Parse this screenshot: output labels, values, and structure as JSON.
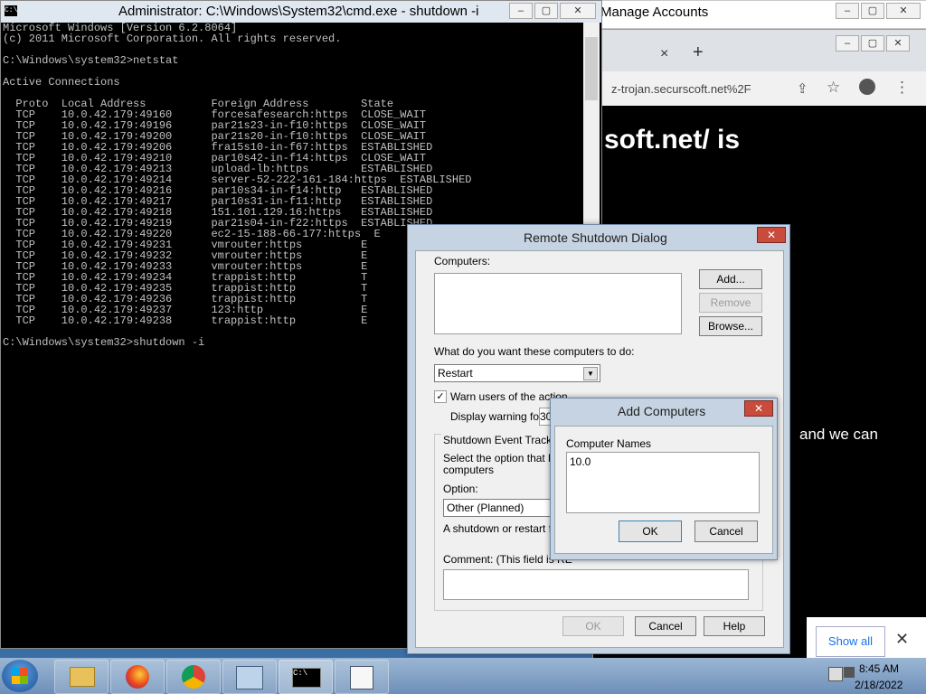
{
  "manage_window": {
    "title": "Manage Accounts"
  },
  "browser": {
    "tab_close": "×",
    "new_tab": "+",
    "url_fragment": "z-trojan.securscoft.net%2F",
    "heading_fragment": "soft.net/ is",
    "body_fragment": "and we can",
    "notification": {
      "show_all": "Show all",
      "close": "✕"
    }
  },
  "cmd": {
    "title": "Administrator: C:\\Windows\\System32\\cmd.exe - shutdown  -i",
    "lines": [
      "Microsoft Windows [Version 6.2.8064]",
      "(c) 2011 Microsoft Corporation. All rights reserved.",
      "",
      "C:\\Windows\\system32>netstat",
      "",
      "Active Connections",
      "",
      "  Proto  Local Address          Foreign Address        State",
      "  TCP    10.0.42.179:49160      forcesafesearch:https  CLOSE_WAIT",
      "  TCP    10.0.42.179:49196      par21s23-in-f10:https  CLOSE_WAIT",
      "  TCP    10.0.42.179:49200      par21s20-in-f10:https  CLOSE_WAIT",
      "  TCP    10.0.42.179:49206      fra15s10-in-f67:https  ESTABLISHED",
      "  TCP    10.0.42.179:49210      par10s42-in-f14:https  CLOSE_WAIT",
      "  TCP    10.0.42.179:49213      upload-lb:https        ESTABLISHED",
      "  TCP    10.0.42.179:49214      server-52-222-161-184:https  ESTABLISHED",
      "  TCP    10.0.42.179:49216      par10s34-in-f14:http   ESTABLISHED",
      "  TCP    10.0.42.179:49217      par10s31-in-f11:http   ESTABLISHED",
      "  TCP    10.0.42.179:49218      151.101.129.16:https   ESTABLISHED",
      "  TCP    10.0.42.179:49219      par21s04-in-f22:https  ESTABLISHED",
      "  TCP    10.0.42.179:49220      ec2-15-188-66-177:https  E",
      "  TCP    10.0.42.179:49231      vmrouter:https         E",
      "  TCP    10.0.42.179:49232      vmrouter:https         E",
      "  TCP    10.0.42.179:49233      vmrouter:https         E",
      "  TCP    10.0.42.179:49234      trappist:http          T",
      "  TCP    10.0.42.179:49235      trappist:http          T",
      "  TCP    10.0.42.179:49236      trappist:http          T",
      "  TCP    10.0.42.179:49237      123:http               E",
      "  TCP    10.0.42.179:49238      trappist:http          E",
      "",
      "C:\\Windows\\system32>shutdown -i"
    ]
  },
  "remote_shutdown": {
    "title": "Remote Shutdown Dialog",
    "close": "✕",
    "computers_label": "Computers:",
    "add_button": "Add...",
    "remove_button": "Remove",
    "browse_button": "Browse...",
    "action_label": "What do you want these computers to do:",
    "action_value": "Restart",
    "warn_checkbox_label": "Warn users of the action",
    "warn_checked": true,
    "display_warning_label": "Display warning for",
    "display_warning_value": "30",
    "tracker_group_label": "Shutdown Event Tracker",
    "tracker_desc": "Select the option that bes",
    "tracker_desc2": "computers",
    "option_label": "Option:",
    "option_value": "Other (Planned)",
    "shutdown_note": "A shutdown or restart for",
    "comment_label": "Comment: (This field is RE",
    "ok_button": "OK",
    "cancel_button": "Cancel",
    "help_button": "Help"
  },
  "add_computers": {
    "title": "Add Computers",
    "close": "✕",
    "names_label": "Computer Names",
    "names_value": "10.0",
    "ok_button": "OK",
    "cancel_button": "Cancel"
  },
  "taskbar": {
    "time": "8:45 AM",
    "date": "2/18/2022",
    "apps": [
      "explorer",
      "firefox",
      "chrome",
      "control-panel",
      "cmd",
      "notepad"
    ]
  }
}
